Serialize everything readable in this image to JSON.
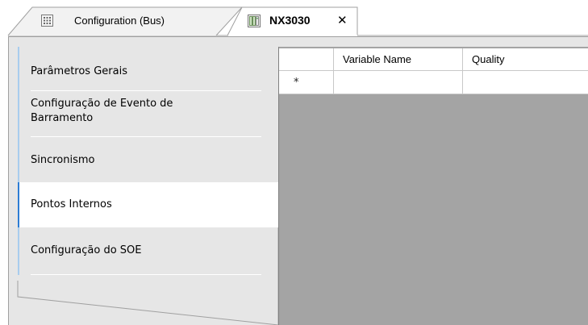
{
  "tabs": [
    {
      "label": "Configuration (Bus)",
      "icon": "grid-device-icon",
      "active": false
    },
    {
      "label": "NX3030",
      "icon": "cpu-module-icon",
      "active": true,
      "close_glyph": "✕"
    }
  ],
  "sidebar": {
    "items": [
      {
        "label": "Parâmetros Gerais"
      },
      {
        "label": "Configuração de Evento de Barramento"
      },
      {
        "label": "Sincronismo"
      },
      {
        "label": "Pontos Internos",
        "selected": true
      },
      {
        "label": "Configuração do SOE"
      }
    ]
  },
  "grid": {
    "columns": [
      "",
      "Variable Name",
      "Quality"
    ],
    "new_row_marker": "*"
  },
  "colors": {
    "selected_marker": "#2c7cd4",
    "item_marker": "#a8cdee",
    "panel_bg": "#e6e6e6",
    "grid_empty_bg": "#a4a4a4"
  }
}
